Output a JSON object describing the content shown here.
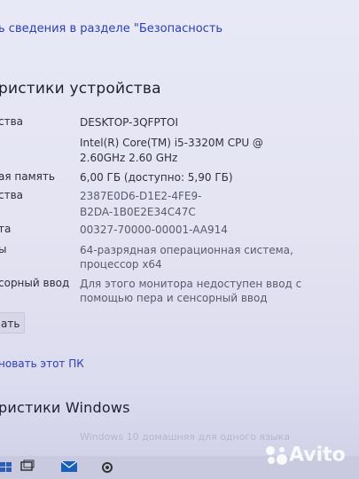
{
  "security_link": "ь сведения в разделе \"Безопасность",
  "device_section_title": "ристики устройства",
  "specs": [
    {
      "label": "ства",
      "value_lines": [
        "DESKTOP-3QFPTOI"
      ]
    },
    {
      "label": "",
      "value_lines": [
        "Intel(R) Core(TM) i5-3320M CPU @",
        "2.60GHz   2.60 GHz"
      ]
    },
    {
      "label": "ая память",
      "value_lines": [
        "6,00 ГБ (доступно: 5,90 ГБ)"
      ]
    },
    {
      "label": "ства",
      "value_lines": [
        "2387E0D6-D1E2-4FE9-",
        "B2DA-1B0E2E34C47C"
      ]
    },
    {
      "label": "та",
      "value_lines": [
        "00327-70000-00001-AA914"
      ]
    },
    {
      "label": "ы",
      "value_lines": [
        "64-разрядная операционная система,",
        "процессор x64"
      ]
    },
    {
      "label": "сорный ввод",
      "value_lines": [
        "Для этого монитора недоступен ввод с",
        "помощью пера и сенсорный ввод"
      ]
    }
  ],
  "copy_button_label": "ать",
  "rename_link": "новать этот ПК",
  "windows_section_title": "ристики Windows",
  "faded_text": "Windows 10 домашняя для одного языка",
  "watermark": "Avito",
  "colors": {
    "link": "#2b3fb5",
    "background": "#e4e4f2",
    "taskbar": "#c9cadf"
  }
}
